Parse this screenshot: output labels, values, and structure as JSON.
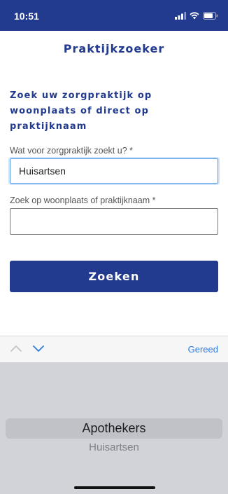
{
  "status_bar": {
    "time": "10:51"
  },
  "header": {
    "title": "Praktijkzoeker"
  },
  "intro": {
    "text": "Zoek uw zorgpraktijk op woonplaats of direct op praktijknaam"
  },
  "form": {
    "type_label": "Wat voor zorgpraktijk zoekt u? *",
    "type_value": "Huisartsen",
    "location_label": "Zoek op woonplaats of praktijknaam *",
    "location_value": "",
    "search_button": "Zoeken"
  },
  "toolbar": {
    "done_label": "Gereed"
  },
  "picker": {
    "options": [
      "Apothekers",
      "Huisartsen"
    ],
    "selected": "Apothekers"
  },
  "colors": {
    "brand": "#223b8f",
    "accent": "#2f7bde",
    "focus": "#5aa0e8"
  }
}
